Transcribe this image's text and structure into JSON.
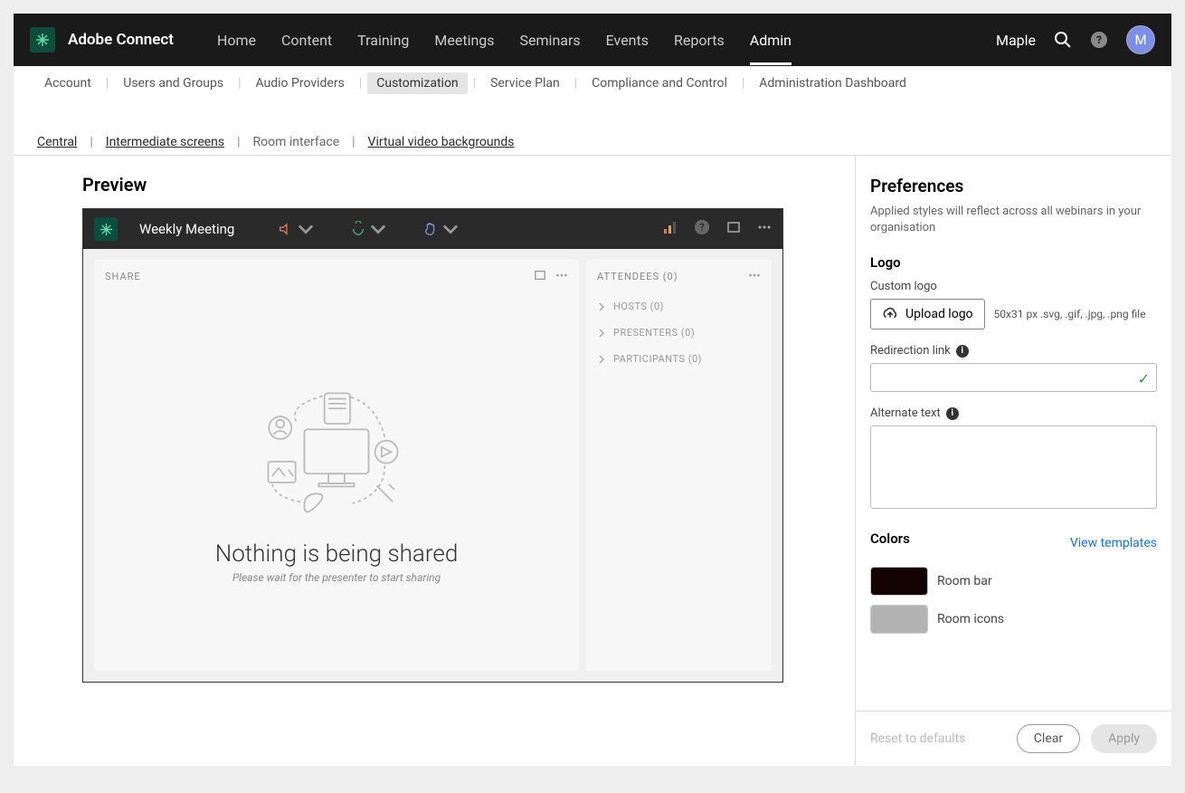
{
  "brand": "Adobe Connect",
  "mainnav": [
    "Home",
    "Content",
    "Training",
    "Meetings",
    "Seminars",
    "Events",
    "Reports",
    "Admin"
  ],
  "mainnav_active": 7,
  "user": {
    "name": "Maple",
    "initial": "M"
  },
  "subnav": [
    "Account",
    "Users and Groups",
    "Audio Providers",
    "Customization",
    "Service Plan",
    "Compliance and Control",
    "Administration Dashboard"
  ],
  "subnav_active": 3,
  "tabs": [
    "Central",
    "Intermediate screens",
    "Room interface",
    "Virtual video backgrounds"
  ],
  "tabs_active": 2,
  "preview": {
    "title": "Preview",
    "room_title": "Weekly Meeting",
    "share_label": "SHARE",
    "attendees_label": "ATTENDEES (0)",
    "groups": [
      "HOSTS (0)",
      "PRESENTERS (0)",
      "PARTICIPANTS (0)"
    ],
    "empty_title": "Nothing is being shared",
    "empty_sub": "Please wait for the presenter to start sharing"
  },
  "prefs": {
    "title": "Preferences",
    "desc": "Applied styles will reflect across all webinars in your organisation",
    "logo_heading": "Logo",
    "custom_logo": "Custom logo",
    "upload": "Upload logo",
    "upload_hint": "50x31 px .svg, .gif, .jpg, .png file",
    "redirect_label": "Redirection link",
    "alt_label": "Alternate text",
    "colors_heading": "Colors",
    "view_templates": "View templates",
    "colors": [
      {
        "label": "Room bar",
        "hex": "#140202"
      },
      {
        "label": "Room icons",
        "hex": "#b3b3b3"
      }
    ],
    "reset": "Reset to defaults",
    "clear": "Clear",
    "apply": "Apply"
  }
}
